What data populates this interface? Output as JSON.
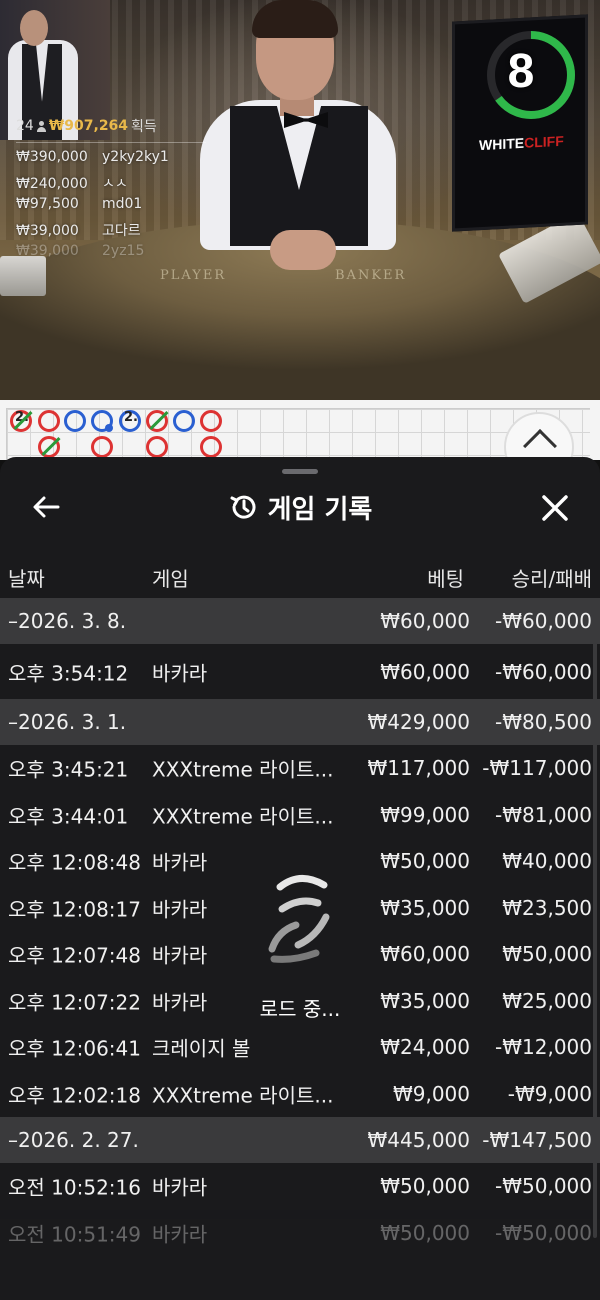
{
  "video": {
    "felt_player": "PLAYER",
    "felt_banker": "BANKER",
    "timer": "8",
    "timer_progress": 0.65,
    "studio_logo_a": "WHITE",
    "studio_logo_b": "CLIFF"
  },
  "winners": {
    "count": "24",
    "total": "₩907,264",
    "suffix": "획득",
    "rows": [
      {
        "amount": "₩390,000",
        "name": "y2ky2ky1"
      },
      {
        "amount": "₩240,000",
        "name": "ㅅㅅ"
      },
      {
        "amount": "₩97,500",
        "name": "md01"
      },
      {
        "amount": "₩39,000",
        "name": "고다르"
      },
      {
        "amount": "₩39,000",
        "name": "2yz15"
      }
    ]
  },
  "roadmap": {
    "cells": [
      "2.",
      "2."
    ]
  },
  "sheet": {
    "title": "게임 기록",
    "columns": {
      "date": "날짜",
      "game": "게임",
      "bet": "베팅",
      "winloss": "승리/패배"
    },
    "loading": "로드 중...",
    "rows": [
      {
        "type": "group",
        "date": "–2026. 3. 8.",
        "bet": "₩60,000",
        "winloss": "-₩60,000"
      },
      {
        "type": "item",
        "date": "오후 3:54:12",
        "game": "바카라",
        "bet": "₩60,000",
        "winloss": "-₩60,000"
      },
      {
        "type": "group",
        "date": "–2026. 3. 1.",
        "bet": "₩429,000",
        "winloss": "-₩80,500"
      },
      {
        "type": "item",
        "date": "오후 3:45:21",
        "game": "XXXtreme 라이트...",
        "bet": "₩117,000",
        "winloss": "-₩117,000"
      },
      {
        "type": "item",
        "date": "오후 3:44:01",
        "game": "XXXtreme 라이트...",
        "bet": "₩99,000",
        "winloss": "-₩81,000"
      },
      {
        "type": "item",
        "date": "오후 12:08:48",
        "game": "바카라",
        "bet": "₩50,000",
        "winloss": "₩40,000"
      },
      {
        "type": "item",
        "date": "오후 12:08:17",
        "game": "바카라",
        "bet": "₩35,000",
        "winloss": "₩23,500"
      },
      {
        "type": "item",
        "date": "오후 12:07:48",
        "game": "바카라",
        "bet": "₩60,000",
        "winloss": "₩50,000"
      },
      {
        "type": "item",
        "date": "오후 12:07:22",
        "game": "바카라",
        "bet": "₩35,000",
        "winloss": "₩25,000"
      },
      {
        "type": "item",
        "date": "오후 12:06:41",
        "game": "크레이지 볼",
        "bet": "₩24,000",
        "winloss": "-₩12,000"
      },
      {
        "type": "item",
        "date": "오후 12:02:18",
        "game": "XXXtreme 라이트...",
        "bet": "₩9,000",
        "winloss": "-₩9,000"
      },
      {
        "type": "group",
        "date": "–2026. 2. 27.",
        "bet": "₩445,000",
        "winloss": "-₩147,500"
      },
      {
        "type": "item",
        "date": "오전 10:52:16",
        "game": "바카라",
        "bet": "₩50,000",
        "winloss": "-₩50,000"
      },
      {
        "type": "item",
        "date": "오전 10:51:49",
        "game": "바카라",
        "bet": "₩50,000",
        "winloss": "-₩50,000"
      }
    ]
  }
}
